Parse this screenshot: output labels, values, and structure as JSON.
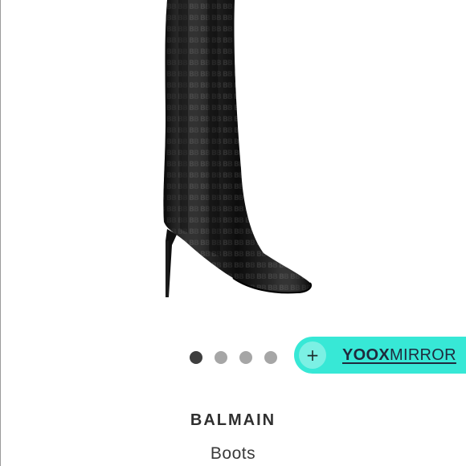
{
  "product": {
    "brand": "BALMAIN",
    "type": "Boots"
  },
  "carousel": {
    "total": 4,
    "active_index": 0
  },
  "mirror_button": {
    "plus": "+",
    "label_bold": "YOOX",
    "label_rest": "MIRROR",
    "color": "#37e8d6"
  },
  "colors": {
    "dot_active": "#3e3e3e",
    "dot_inactive": "#a6a6a6"
  }
}
